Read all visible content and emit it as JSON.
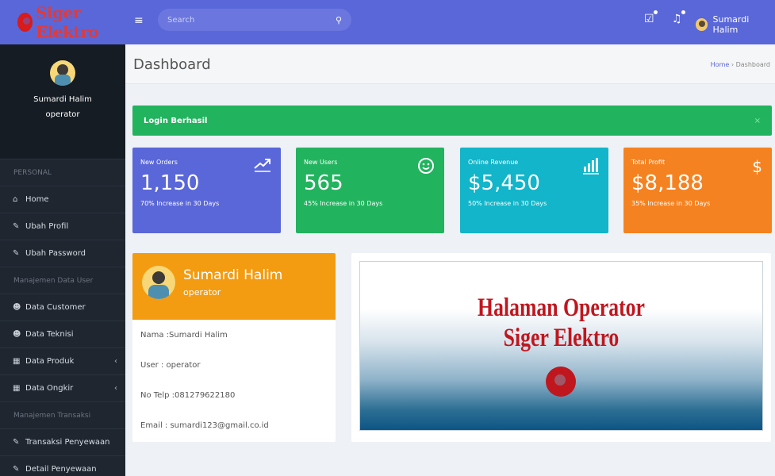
{
  "brand": {
    "name": "Siger Elektro"
  },
  "topbar": {
    "search_placeholder": "Search",
    "user_name": "Sumardi Halim"
  },
  "sidebar": {
    "profile": {
      "name": "Sumardi Halim",
      "role": "operator"
    },
    "sections": [
      {
        "label": "PERSONAL"
      },
      {
        "label": "Manajemen Data User"
      },
      {
        "label": "Manajemen Transaksi"
      }
    ],
    "items": [
      {
        "label": "Home",
        "icon": "home-icon"
      },
      {
        "label": "Ubah Profil",
        "icon": "edit-icon"
      },
      {
        "label": "Ubah Password",
        "icon": "edit-icon"
      },
      {
        "label": "Data Customer",
        "icon": "users-icon"
      },
      {
        "label": "Data Teknisi",
        "icon": "users-icon"
      },
      {
        "label": "Data Produk",
        "icon": "grid-icon"
      },
      {
        "label": "Data Ongkir",
        "icon": "grid-icon"
      },
      {
        "label": "Transaksi Penyewaan",
        "icon": "edit-icon"
      },
      {
        "label": "Detail Penyewaan",
        "icon": "edit-icon"
      }
    ]
  },
  "header": {
    "title": "Dashboard",
    "breadcrumb_home": "Home",
    "breadcrumb_sep": " › ",
    "breadcrumb_current": "Dashboard"
  },
  "alert": {
    "text": "Login Berhasil",
    "close": "×"
  },
  "stats": [
    {
      "label": "New Orders",
      "value": "1,150",
      "sub": "70% Increase in 30 Days",
      "color": "#5a67d8",
      "icon": "trend-up-icon"
    },
    {
      "label": "New Users",
      "value": "565",
      "sub": "45% Increase in 30 Days",
      "color": "#22b35e",
      "icon": "smile-icon"
    },
    {
      "label": "Online Revenue",
      "value": "$5,450",
      "sub": "50% Increase in 30 Days",
      "color": "#12b5c9",
      "icon": "bar-chart-icon"
    },
    {
      "label": "Total Profit",
      "value": "$8,188",
      "sub": "35% Increase in 30 Days",
      "color": "#f58220",
      "icon": "dollar-icon"
    }
  ],
  "profile_card": {
    "name": "Sumardi Halim",
    "role": "operator",
    "nama": "Nama :Sumardi Halim",
    "user": "User : operator",
    "telp": "No Telp :081279622180",
    "email": "Email : sumardi123@gmail.co.id"
  },
  "banner": {
    "line1": "Halaman Operator",
    "line2": "Siger Elektro"
  }
}
